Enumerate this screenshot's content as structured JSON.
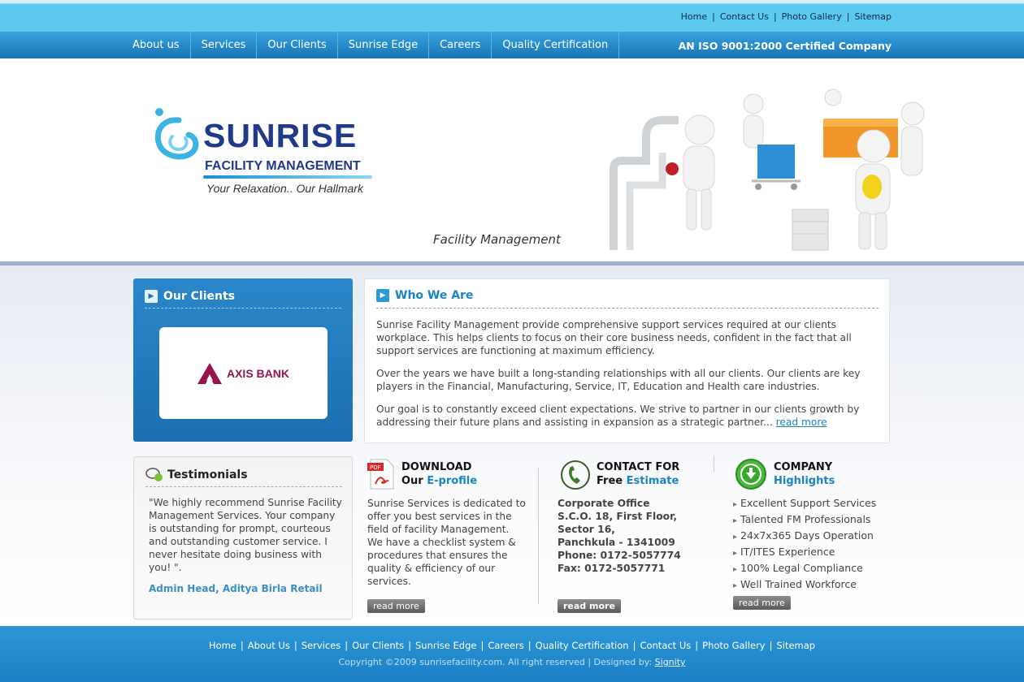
{
  "top_links": [
    "Home",
    "Contact Us",
    "Photo Gallery",
    "Sitemap"
  ],
  "nav": [
    "About us",
    "Services",
    "Our Clients",
    "Sunrise Edge",
    "Careers",
    "Quality Certification"
  ],
  "iso_text": "AN ISO 9001:2000 Certified Company",
  "logo": {
    "name": "SUNRISE",
    "sub": "FACILITY MANAGEMENT",
    "tagline": "Your Relaxation.. Our Hallmark"
  },
  "header_caption": "Facility Management",
  "clients": {
    "title": "Our Clients",
    "client_name": "AXIS BANK"
  },
  "who": {
    "title": "Who We Are",
    "p1": "Sunrise Facility Management provide comprehensive support services required at our clients workplace. This helps clients to focus on their core business needs, confident in the fact that all support services are functioning at maximum efficiency.",
    "p2": "Over the years we have built a long-standing relationships with all our clients. Our clients are key players in the Financial, Manufacturing, Service, IT, Education and Health care industries.",
    "p3": "Our goal is to constantly exceed client expectations. We strive to partner in our clients growth by addressing their future plans and assisting in expansion as a strategic partner...",
    "read_more": "read more"
  },
  "testimonials": {
    "title": "Testimonials",
    "quote": "\"We highly recommend Sunrise Facility Management Services. Your company is outstanding for prompt, courteous and outstanding customer service. I never hesitate doing business with you! \".",
    "author": "Admin Head, Aditya Birla Retail"
  },
  "download": {
    "head1": "DOWNLOAD",
    "head2a": "Our ",
    "head2b": "E-profile",
    "text": "Sunrise Services is dedicated to offer you best services in the field of facility Management. We have a checklist system & procedures that ensures the quality & efficiency of our services.",
    "button": "read more"
  },
  "contact": {
    "head1": "CONTACT FOR",
    "head2a": "Free ",
    "head2b": "Estimate",
    "lines": [
      "Corporate Office",
      "S.C.O. 18, First Floor,",
      "Sector 16,",
      "Panchkula - 1341009",
      "Phone: 0172-5057774",
      "Fax: 0172-5057771"
    ],
    "button": "read more"
  },
  "company": {
    "head1": "COMPANY",
    "head2": "Highlights",
    "items": [
      "Excellent Support Services",
      "Talented FM Professionals",
      "24x7x365 Days Operation",
      "IT/ITES Experience",
      "100% Legal Compliance",
      "Well Trained Workforce"
    ],
    "button": "read more"
  },
  "footer": {
    "links": [
      "Home",
      "About Us",
      "Services",
      "Our Clients",
      "Sunrise Edge",
      "Careers",
      "Quality Certification",
      "Contact Us",
      "Photo Gallery",
      "Sitemap"
    ],
    "copyright": "Copyright ©2009 sunrisefacility.com. All right reserved | Designed by: ",
    "designer": "Signity"
  }
}
